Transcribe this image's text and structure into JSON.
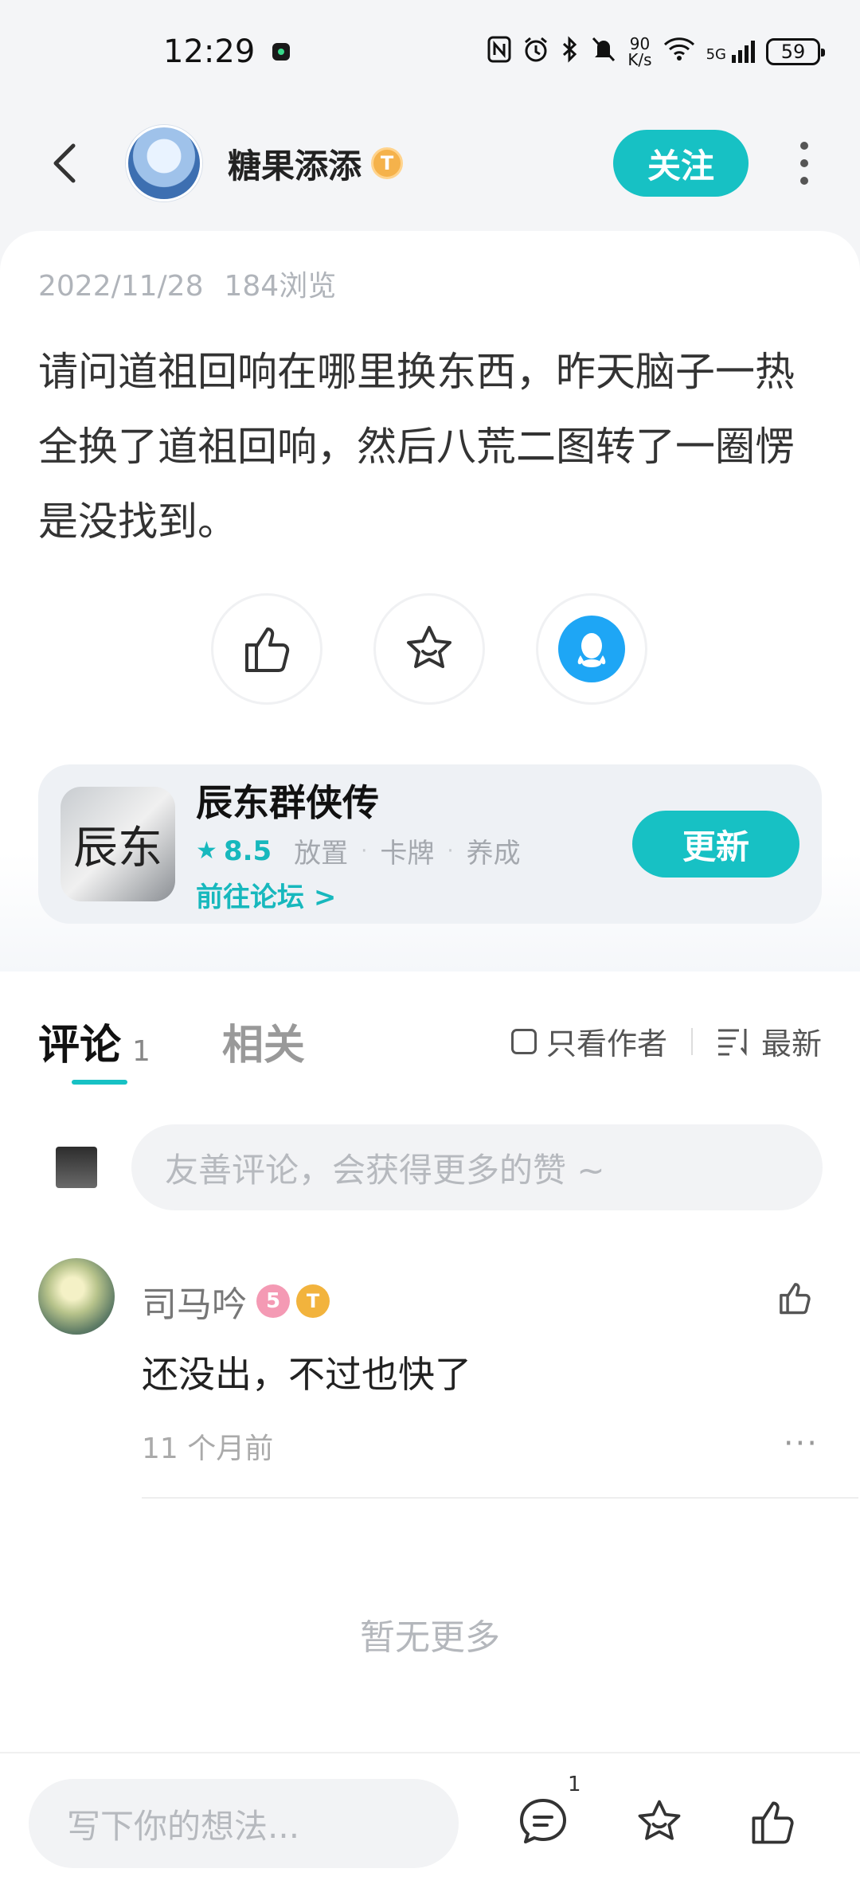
{
  "status_bar": {
    "time": "12:29",
    "net_speed_top": "90",
    "net_speed_bottom": "K/s",
    "battery": "59",
    "signal_label": "5G"
  },
  "header": {
    "username": "糖果添添",
    "level_badge": "T",
    "follow_label": "关注"
  },
  "post": {
    "date": "2022/11/28",
    "views": "184浏览",
    "content": "请问道祖回响在哪里换东西，昨天脑子一热全换了道祖回响，然后八荒二图转了一圈愣是没找到。"
  },
  "game_card": {
    "logo_text": "辰东",
    "title": "辰东群侠传",
    "rating": "8.5",
    "tags": [
      "放置",
      "卡牌",
      "养成"
    ],
    "forum_link": "前往论坛 >",
    "update_label": "更新"
  },
  "tabs": {
    "comment_label": "评论",
    "comment_count": "1",
    "related_label": "相关",
    "author_only_label": "只看作者",
    "sort_label": "最新"
  },
  "comment_input": {
    "placeholder": "友善评论，会获得更多的赞 ~"
  },
  "comments": [
    {
      "name": "司马吟",
      "badge1": "5",
      "badge2": "T",
      "text": "还没出，不过也快了",
      "time": "11 个月前",
      "more": "···"
    }
  ],
  "no_more": "暂无更多",
  "bottom_bar": {
    "placeholder": "写下你的想法...",
    "comment_count": "1"
  }
}
